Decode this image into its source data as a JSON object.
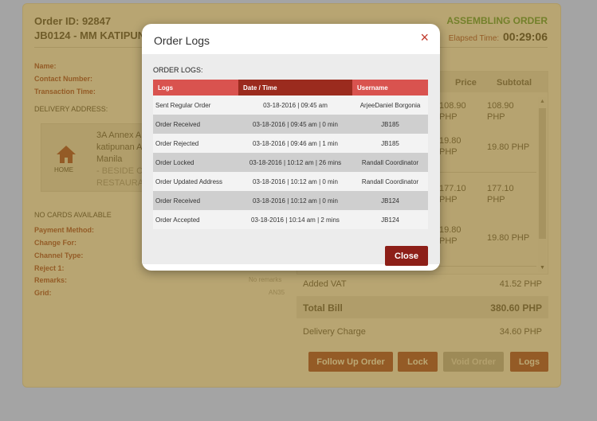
{
  "order": {
    "id_line": "Order ID: 92847",
    "store_line": "JB0124 - MM KATIPUNA",
    "status": "ASSEMBLING ORDER",
    "elapsed_label": "Elapsed Time:",
    "elapsed_value": "00:29:06"
  },
  "customer": {
    "name_label": "Name:",
    "contact_label": "Contact Number:",
    "transaction_label": "Transaction Time:",
    "delivery_title": "DELIVERY ADDRESS:",
    "home_label": "HOME",
    "address_lines": [
      "3A Annex A",
      "katipunan A",
      "Manila"
    ],
    "address_sub_lines": [
      "- BESIDE C",
      "RESTAURA"
    ],
    "no_cards": "NO CARDS AVAILABLE"
  },
  "details": {
    "payment_label": "Payment Method:",
    "change_label": "Change For:",
    "channel_label": "Channel Type:",
    "reject_label": "Reject 1:",
    "remarks_label": "Remarks:",
    "remarks_value": "No remarks",
    "grid_label": "Grid:",
    "grid_value": "AN35"
  },
  "items": {
    "price_header": "Price",
    "subtotal_header": "Subtotal",
    "rows": [
      {
        "price": "108.90",
        "price_unit": "PHP",
        "subtotal": "108.90",
        "subtotal_unit": "PHP"
      },
      {
        "price": "19.80",
        "price_unit": "PHP",
        "subtotal": "19.80 PHP"
      },
      {
        "price": "177.10",
        "price_unit": "PHP",
        "subtotal": "177.10",
        "subtotal_unit": "PHP"
      },
      {
        "price": "19.80",
        "price_unit": "PHP",
        "subtotal": "19.80 PHP"
      }
    ]
  },
  "summary": {
    "vat_label": "Added VAT",
    "vat_value": "41.52 PHP",
    "total_label": "Total Bill",
    "total_value": "380.60 PHP",
    "delivery_label": "Delivery Charge",
    "delivery_value": "34.60 PHP"
  },
  "actions": {
    "follow_up": "Follow Up Order",
    "lock": "Lock",
    "void": "Void Order",
    "logs": "Logs"
  },
  "modal": {
    "title": "Order Logs",
    "close_x": "×",
    "caption": "ORDER LOGS:",
    "headers": [
      "Logs",
      "Date / Time",
      "Username"
    ],
    "rows": [
      [
        "Sent Regular Order",
        "03-18-2016 | 09:45 am",
        "ArjeeDaniel Borgonia"
      ],
      [
        "Order Received",
        "03-18-2016 | 09:45 am | 0 min",
        "JB185"
      ],
      [
        "Order Rejected",
        "03-18-2016 | 09:46 am | 1 min",
        "JB185"
      ],
      [
        "Order Locked",
        "03-18-2016 | 10:12 am | 26 mins",
        "Randall Coordinator"
      ],
      [
        "Order Updated Address",
        "03-18-2016 | 10:12 am | 0 min",
        "Randall Coordinator"
      ],
      [
        "Order Received",
        "03-18-2016 | 10:12 am | 0 min",
        "JB124"
      ],
      [
        "Order Accepted",
        "03-18-2016 | 10:14 am | 2 mins",
        "JB124"
      ]
    ],
    "close_button": "Close"
  },
  "colors": {
    "brand_red": "#8d1f18",
    "status_green": "#2e8b24",
    "header_red": "#d9534f",
    "overlay_gold": "#cd9b14"
  }
}
